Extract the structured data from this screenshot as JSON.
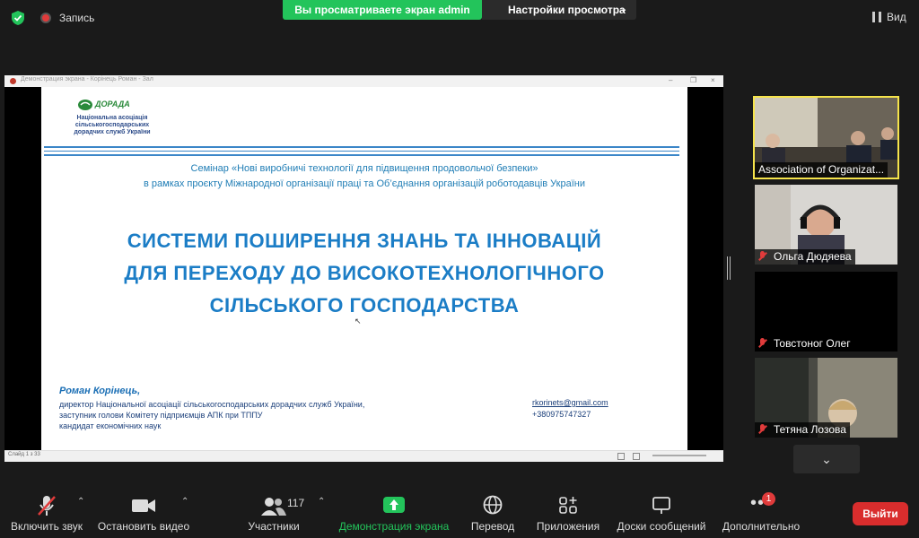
{
  "topbar": {
    "recording_label": "Запись",
    "viewing_banner": "Вы просматриваете экран admin",
    "view_options_label": "Настройки просмотра",
    "view_button_label": "Вид"
  },
  "share_window": {
    "title": "Демонстрация экрана - Корінець Роман - Зал",
    "status_page": "Слайд 1 з 33"
  },
  "slide": {
    "logo_name": "ДОРАДА",
    "logo_sub_lines": [
      "Національна асоціація",
      "сільськогосподарських",
      "дорадчих служб України"
    ],
    "seminar_line1": "Семінар «Нові виробничі технології для підвищення продовольчої безпеки»",
    "seminar_line2": "в рамках проєкту Міжнародної організації праці та Об’єднання організацій роботодавців України",
    "title_lines": [
      "СИСТЕМИ ПОШИРЕННЯ ЗНАНЬ ТА ІННОВАЦІЙ",
      "ДЛЯ ПЕРЕХОДУ ДО ВИСОКОТЕХНОЛОГІЧНОГО",
      "СІЛЬСЬКОГО ГОСПОДАРСТВА"
    ],
    "author": "Роман Корінець,",
    "positions": [
      "директор Національної асоціації сільськогосподарських дорадчих служб України,",
      "заступник голови Комітету підприємців АПК при ТППУ",
      "кандидат економічних наук"
    ],
    "email": "rkorinets@gmail.com",
    "phone": "+380975747327"
  },
  "participants": [
    {
      "name": "Association of Organizat...",
      "muted": false,
      "active": true
    },
    {
      "name": "Ольга Дюдяева",
      "muted": true,
      "active": false
    },
    {
      "name": "Товстоног Олег",
      "muted": true,
      "active": false
    },
    {
      "name": "Тетяна Лозова",
      "muted": true,
      "active": false
    }
  ],
  "toolbar": {
    "mute_label": "Включить звук",
    "video_label": "Остановить видео",
    "participants_label": "Участники",
    "participants_count": "117",
    "share_label": "Демонстрация экрана",
    "translate_label": "Перевод",
    "apps_label": "Приложения",
    "whiteboard_label": "Доски сообщений",
    "more_label": "Дополнительно",
    "more_badge": "1",
    "leave_label": "Выйти"
  },
  "colors": {
    "share_green": "#23c45b",
    "leave_red": "#d92d2d",
    "active_speaker": "#f6e44b",
    "slide_title_blue": "#1b7dc6"
  }
}
